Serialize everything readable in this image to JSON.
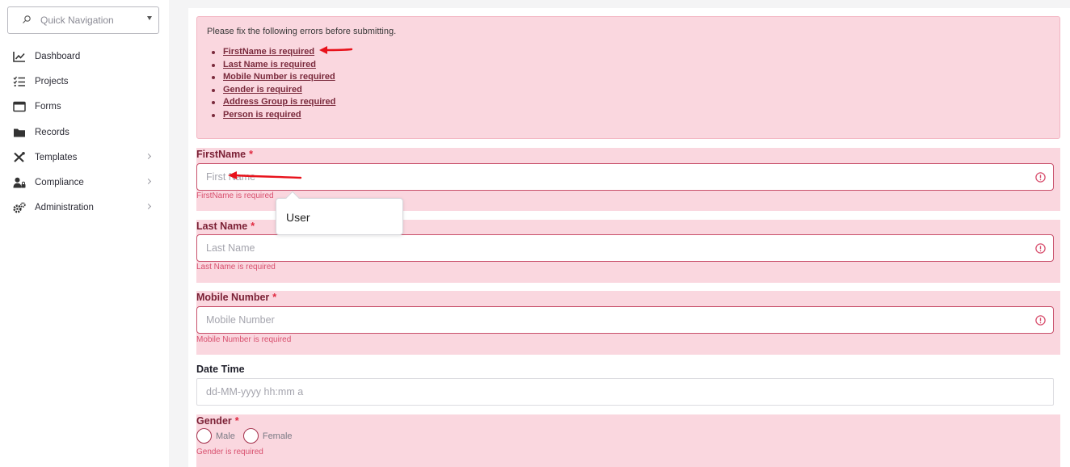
{
  "sidebar": {
    "quick_nav_placeholder": "Quick Navigation",
    "items": [
      {
        "label": "Dashboard",
        "icon": "chart-line-icon",
        "has_children": false
      },
      {
        "label": "Projects",
        "icon": "list-check-icon",
        "has_children": false
      },
      {
        "label": "Forms",
        "icon": "window-icon",
        "has_children": false
      },
      {
        "label": "Records",
        "icon": "folder-icon",
        "has_children": false
      },
      {
        "label": "Templates",
        "icon": "tools-icon",
        "has_children": true
      },
      {
        "label": "Compliance",
        "icon": "user-lock-icon",
        "has_children": true
      },
      {
        "label": "Administration",
        "icon": "gears-icon",
        "has_children": true
      }
    ]
  },
  "error_summary": {
    "heading": "Please fix the following errors before submitting.",
    "errors": [
      "FirstName is required",
      "Last Name is required",
      "Mobile Number is required",
      "Gender is required",
      "Address Group is required",
      "Person is required"
    ]
  },
  "form": {
    "first_name": {
      "label": "FirstName",
      "required_mark": "*",
      "placeholder": "First Name",
      "error": "FirstName is required"
    },
    "last_name": {
      "label": "Last Name",
      "required_mark": "*",
      "placeholder": "Last Name",
      "error": "Last Name is required"
    },
    "mobile_number": {
      "label": "Mobile Number",
      "required_mark": "*",
      "placeholder": "Mobile Number",
      "error": "Mobile Number is required"
    },
    "date_time": {
      "label": "Date Time",
      "placeholder": "dd-MM-yyyy hh:mm a"
    },
    "gender": {
      "label": "Gender",
      "required_mark": "*",
      "options": [
        "Male",
        "Female"
      ],
      "error": "Gender is required"
    }
  },
  "tooltip": {
    "text": "User"
  },
  "colors": {
    "error_bg": "#fad7df",
    "error_border": "#c8506b",
    "error_text": "#d8506e",
    "annotation_arrow": "#e8121b"
  }
}
